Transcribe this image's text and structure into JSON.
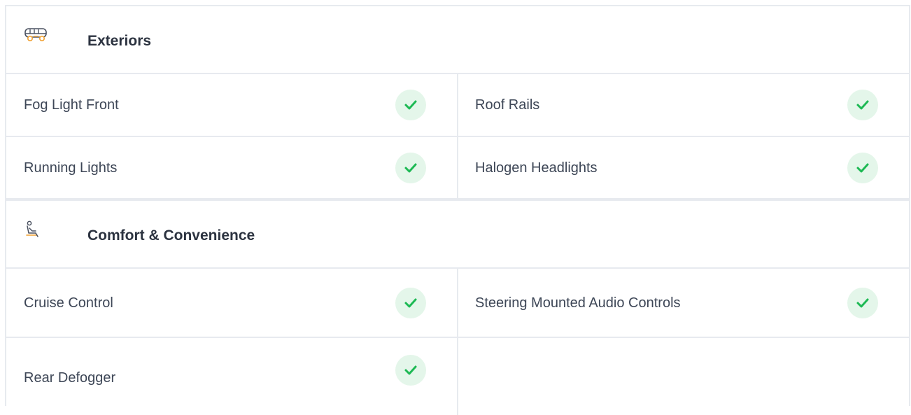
{
  "sections": [
    {
      "title": "Exteriors",
      "icon": "car-icon",
      "rows": [
        [
          "Fog Light Front",
          "Roof Rails"
        ],
        [
          "Running Lights",
          "Halogen Headlights"
        ]
      ]
    },
    {
      "title": "Comfort & Convenience",
      "icon": "seat-icon",
      "rows": [
        [
          "Cruise Control",
          "Steering Mounted Audio Controls"
        ],
        [
          "Rear Defogger",
          ""
        ]
      ]
    }
  ],
  "colors": {
    "check_green": "#1db954",
    "check_bg": "#e4f6ea",
    "border": "#e7eaef",
    "icon_orange": "#f0a030"
  },
  "check_icon": "check-icon"
}
